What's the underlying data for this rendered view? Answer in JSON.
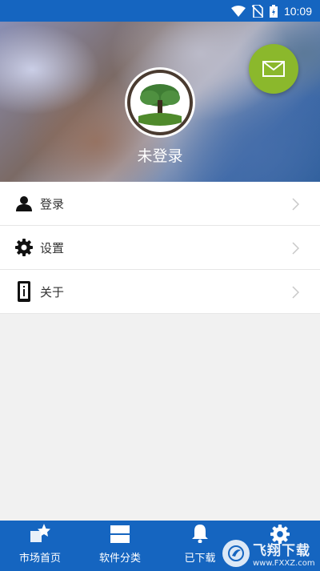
{
  "status_bar": {
    "time": "10:09"
  },
  "profile": {
    "username": "未登录"
  },
  "menu": {
    "items": [
      {
        "label": "登录",
        "icon": "person-icon"
      },
      {
        "label": "设置",
        "icon": "gear-icon"
      },
      {
        "label": "关于",
        "icon": "info-phone-icon"
      }
    ]
  },
  "bottom_nav": {
    "items": [
      {
        "label": "市场首页",
        "icon": "market-star-icon"
      },
      {
        "label": "软件分类",
        "icon": "category-icon"
      },
      {
        "label": "已下载",
        "icon": "bell-icon"
      },
      {
        "label": "",
        "icon": "gear-icon"
      }
    ]
  },
  "watermark": {
    "title": "飞翔下载",
    "url": "www.FXXZ.com"
  },
  "colors": {
    "primary": "#1565c0",
    "fab": "#8bb82c",
    "background": "#f1f1f1"
  }
}
